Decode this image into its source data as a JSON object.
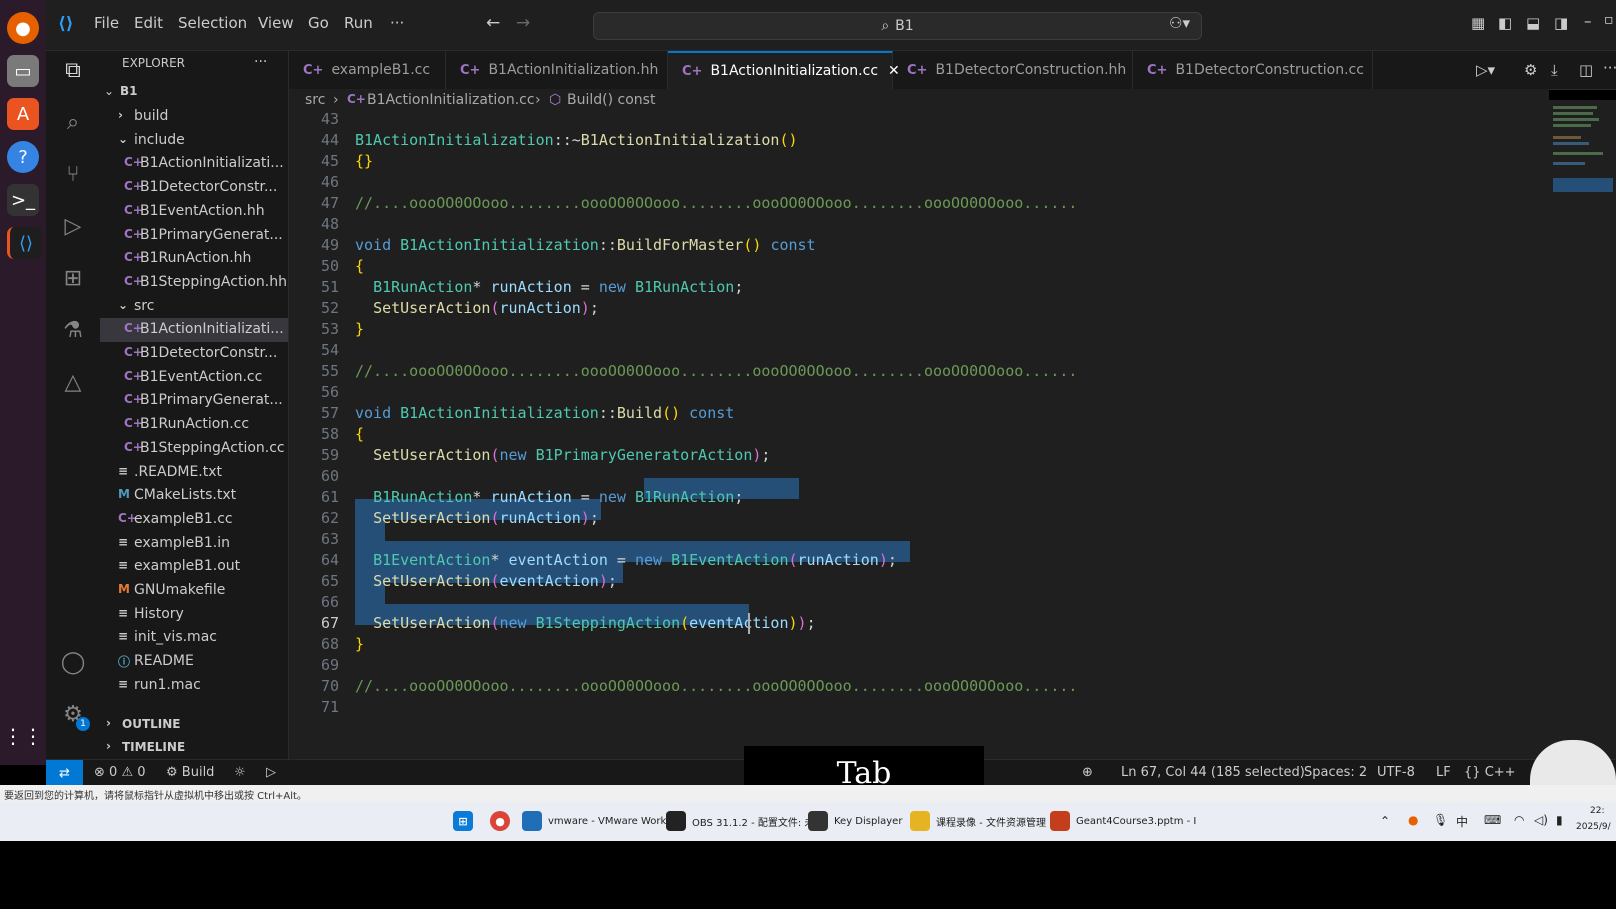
{
  "titlebar": {
    "menu": [
      "File",
      "Edit",
      "Selection",
      "View",
      "Go",
      "Run",
      "···"
    ],
    "search_text": "B1"
  },
  "sidebar": {
    "title": "EXPLORER",
    "more": "···",
    "root": "B1",
    "items": [
      {
        "label": "build",
        "type": "folder-collapsed",
        "depth": 1
      },
      {
        "label": "include",
        "type": "folder-open",
        "depth": 1
      },
      {
        "label": "B1ActionInitializati...",
        "type": "cpp",
        "depth": 2
      },
      {
        "label": "B1DetectorConstr...",
        "type": "cpp",
        "depth": 2
      },
      {
        "label": "B1EventAction.hh",
        "type": "cpp",
        "depth": 2
      },
      {
        "label": "B1PrimaryGenerat...",
        "type": "cpp",
        "depth": 2
      },
      {
        "label": "B1RunAction.hh",
        "type": "cpp",
        "depth": 2
      },
      {
        "label": "B1SteppingAction.hh",
        "type": "cpp",
        "depth": 2
      },
      {
        "label": "src",
        "type": "folder-open",
        "depth": 1
      },
      {
        "label": "B1ActionInitializati...",
        "type": "cpp",
        "depth": 2,
        "selected": true
      },
      {
        "label": "B1DetectorConstr...",
        "type": "cpp",
        "depth": 2
      },
      {
        "label": "B1EventAction.cc",
        "type": "cpp",
        "depth": 2
      },
      {
        "label": "B1PrimaryGenerat...",
        "type": "cpp",
        "depth": 2
      },
      {
        "label": "B1RunAction.cc",
        "type": "cpp",
        "depth": 2
      },
      {
        "label": "B1SteppingAction.cc",
        "type": "cpp",
        "depth": 2
      },
      {
        "label": ".README.txt",
        "type": "text",
        "depth": 1
      },
      {
        "label": "CMakeLists.txt",
        "type": "cmake",
        "depth": 1
      },
      {
        "label": "exampleB1.cc",
        "type": "cpp",
        "depth": 1
      },
      {
        "label": "exampleB1.in",
        "type": "text",
        "depth": 1
      },
      {
        "label": "exampleB1.out",
        "type": "text",
        "depth": 1
      },
      {
        "label": "GNUmakefile",
        "type": "make",
        "depth": 1
      },
      {
        "label": "History",
        "type": "text",
        "depth": 1
      },
      {
        "label": "init_vis.mac",
        "type": "text",
        "depth": 1
      },
      {
        "label": "README",
        "type": "info",
        "depth": 1
      },
      {
        "label": "run1.mac",
        "type": "text",
        "depth": 1
      }
    ],
    "outline": "OUTLINE",
    "timeline": "TIMELINE"
  },
  "tabs": [
    {
      "label": "exampleB1.cc",
      "active": false
    },
    {
      "label": "B1ActionInitialization.hh",
      "active": false
    },
    {
      "label": "B1ActionInitialization.cc",
      "active": true
    },
    {
      "label": "B1DetectorConstruction.hh",
      "active": false
    },
    {
      "label": "B1DetectorConstruction.cc",
      "active": false
    }
  ],
  "breadcrumb": {
    "folder": "src",
    "file": "B1ActionInitialization.cc",
    "symbol": "Build() const"
  },
  "editor": {
    "line_numbers": [
      "43",
      "44",
      "45",
      "46",
      "47",
      "48",
      "49",
      "50",
      "51",
      "52",
      "53",
      "54",
      "55",
      "56",
      "57",
      "58",
      "59",
      "60",
      "61",
      "62",
      "63",
      "64",
      "65",
      "66",
      "67",
      "68",
      "69",
      "70",
      "71"
    ],
    "current_line": "67"
  },
  "status": {
    "errors": "0",
    "warnings": "0",
    "build": "Build",
    "position": "Ln 67, Col 44 (185 selected)",
    "spaces": "Spaces: 2",
    "encoding": "UTF-8",
    "eol": "LF",
    "language": "C++"
  },
  "key_display": "Tab",
  "vmware_hint": "要返回到您的计算机，请将鼠标指针从虚拟机中移出或按 Ctrl+Alt。",
  "taskbar": {
    "apps": [
      {
        "label": "vmware - VMware Work",
        "color": "#1f6fb8"
      },
      {
        "label": "OBS 31.1.2 - 配置文件: 未",
        "color": "#222222"
      },
      {
        "label": "Key Displayer",
        "color": "#333333"
      },
      {
        "label": "课程录像 - 文件资源管理",
        "color": "#e6b422"
      },
      {
        "label": "Geant4Course3.pptm - I",
        "color": "#c43e1c"
      }
    ],
    "clock_time": "22:",
    "clock_date": "2025/9/"
  }
}
